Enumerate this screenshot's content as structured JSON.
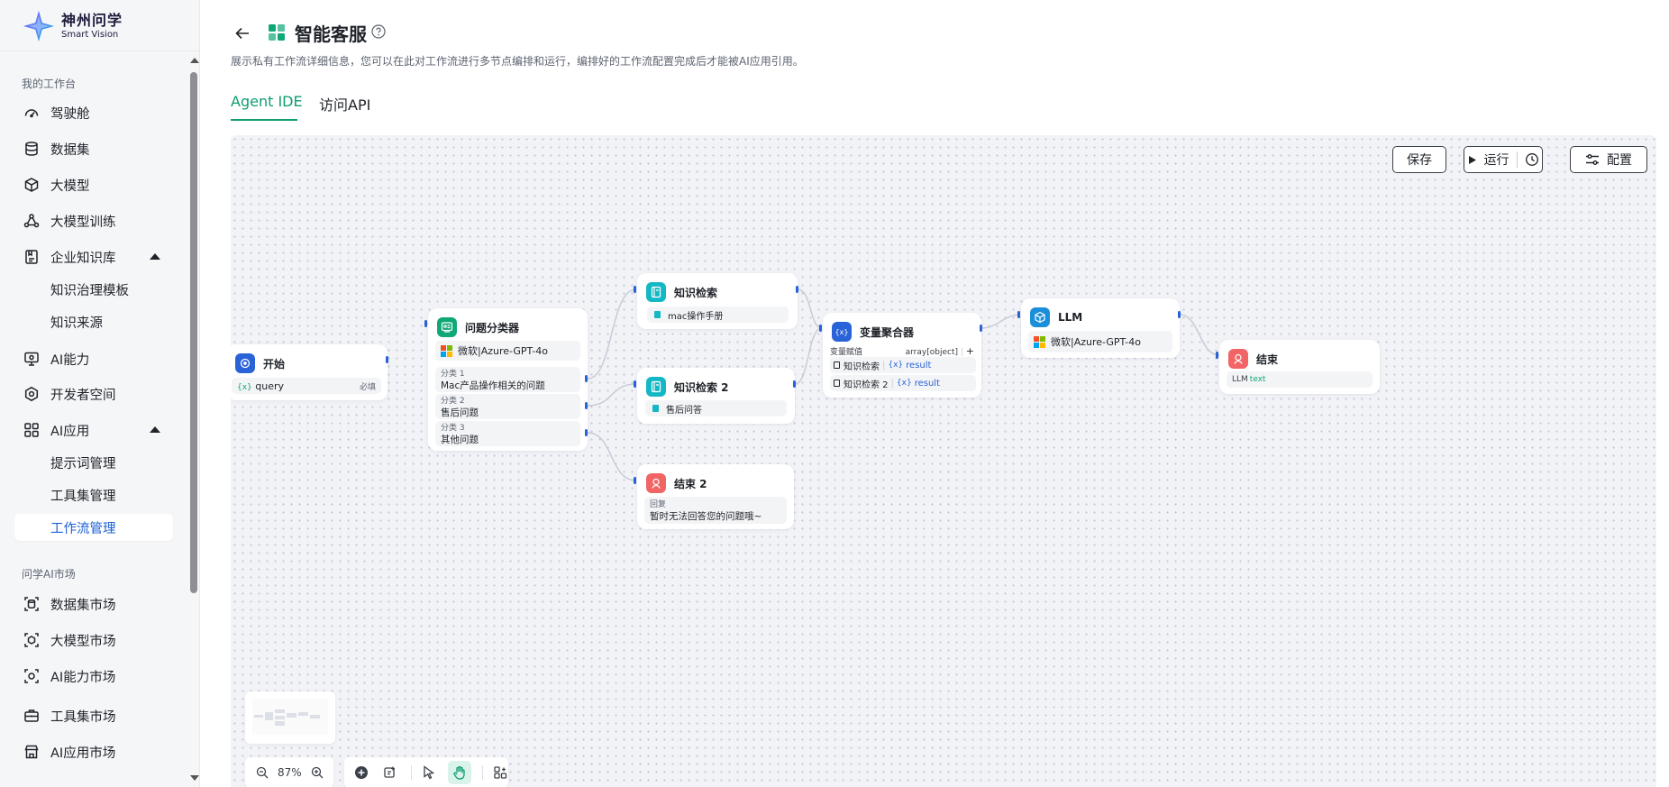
{
  "brand": {
    "name_cn": "神州问学",
    "name_en": "Smart Vision"
  },
  "sidebar": {
    "group1_label": "我的工作台",
    "items": [
      {
        "label": "驾驶舱",
        "icon": "dashboard-icon"
      },
      {
        "label": "数据集",
        "icon": "database-icon"
      },
      {
        "label": "大模型",
        "icon": "cube-icon"
      },
      {
        "label": "大模型训练",
        "icon": "training-icon"
      },
      {
        "label": "企业知识库",
        "icon": "knowledge-icon",
        "expanded": true,
        "children": [
          "知识治理模板",
          "知识来源"
        ]
      },
      {
        "label": "AI能力",
        "icon": "monitor-icon"
      },
      {
        "label": "开发者空间",
        "icon": "developer-icon"
      },
      {
        "label": "AI应用",
        "icon": "apps-icon",
        "expanded": true,
        "children": [
          "提示词管理",
          "工具集管理",
          "工作流管理"
        ]
      }
    ],
    "active_child": "工作流管理",
    "group2_label": "问学AI市场",
    "market_items": [
      {
        "label": "数据集市场",
        "icon": "dataset-market-icon"
      },
      {
        "label": "大模型市场",
        "icon": "model-market-icon"
      },
      {
        "label": "AI能力市场",
        "icon": "ai-market-icon"
      },
      {
        "label": "工具集市场",
        "icon": "toolbox-market-icon"
      },
      {
        "label": "AI应用市场",
        "icon": "app-market-icon"
      }
    ]
  },
  "header": {
    "title": "智能客服",
    "description": "展示私有工作流详细信息，您可以在此对工作流进行多节点编排和运行，编排好的工作流配置完成后才能被AI应用引用。",
    "tabs": [
      "Agent IDE",
      "访问API"
    ],
    "active_tab": "Agent IDE"
  },
  "toolbar": {
    "save_label": "保存",
    "run_label": "运行",
    "config_label": "配置"
  },
  "nodes": {
    "start": {
      "title": "开始",
      "var_icon": "{x}",
      "var_name": "query",
      "required": "必填"
    },
    "classifier": {
      "title": "问题分类器",
      "model": "微软|Azure-GPT-4o",
      "classes": [
        {
          "label": "分类 1",
          "value": "Mac产品操作相关的问题"
        },
        {
          "label": "分类 2",
          "value": "售后问题"
        },
        {
          "label": "分类 3",
          "value": "其他问题"
        }
      ]
    },
    "kb1": {
      "title": "知识检索",
      "dataset": "mac操作手册"
    },
    "kb2": {
      "title": "知识检索 2",
      "dataset": "售后问答"
    },
    "end2": {
      "title": "结束 2",
      "label": "回复",
      "value": "暂时无法回答您的问题哦~"
    },
    "aggregator": {
      "title": "变量聚合器",
      "header_left": "变量赋值",
      "header_right": "array[object]",
      "add": "+",
      "rows": [
        {
          "source": "知识检索",
          "var_icon": "{x}",
          "var": "result"
        },
        {
          "source": "知识检索 2",
          "var_icon": "{x}",
          "var": "result"
        }
      ]
    },
    "llm": {
      "title": "LLM",
      "model": "微软|Azure-GPT-4o"
    },
    "end": {
      "title": "结束",
      "source": "LLM",
      "var": "text"
    }
  },
  "zoom": {
    "level": "87%"
  },
  "colors": {
    "accent_green": "#0f9d72",
    "accent_blue": "#2a63d8",
    "teal": "#14b8c4",
    "red": "#f16566",
    "ms_red": "#f25022",
    "ms_green": "#7fba00",
    "ms_blue": "#00a4ef",
    "ms_yellow": "#ffb900"
  }
}
